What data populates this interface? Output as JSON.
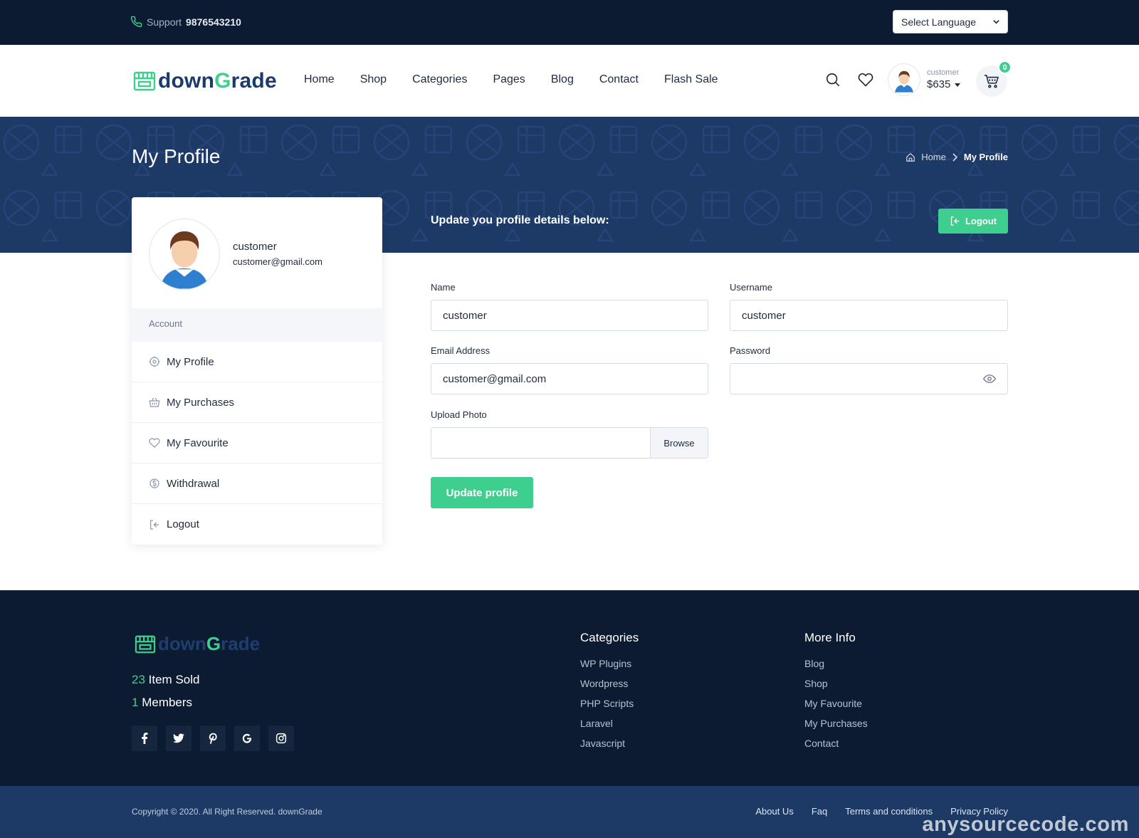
{
  "topbar": {
    "support_label": "Support",
    "support_phone": "9876543210",
    "language_select": "Select Language"
  },
  "header": {
    "logo_part1": "down",
    "logo_g": "G",
    "logo_part2": "rade",
    "nav": [
      "Home",
      "Shop",
      "Categories",
      "Pages",
      "Blog",
      "Contact",
      "Flash Sale"
    ],
    "user": {
      "username": "customer",
      "balance": "$635"
    },
    "cart_count": "0"
  },
  "banner": {
    "title": "My Profile",
    "breadcrumb_home": "Home",
    "breadcrumb_current": "My Profile",
    "update_title": "Update you profile details below:",
    "logout_label": "Logout"
  },
  "sidebar": {
    "name": "customer",
    "email": "customer@gmail.com",
    "section_label": "Account",
    "items": [
      {
        "label": "My Profile",
        "icon": "gear-icon"
      },
      {
        "label": "My Purchases",
        "icon": "basket-icon"
      },
      {
        "label": "My Favourite",
        "icon": "heart-icon"
      },
      {
        "label": "Withdrawal",
        "icon": "money-icon"
      },
      {
        "label": "Logout",
        "icon": "logout-icon"
      }
    ]
  },
  "form": {
    "name_label": "Name",
    "name_value": "customer",
    "username_label": "Username",
    "username_value": "customer",
    "email_label": "Email Address",
    "email_value": "customer@gmail.com",
    "password_label": "Password",
    "password_value": "",
    "upload_label": "Upload Photo",
    "browse_label": "Browse",
    "submit_label": "Update profile"
  },
  "footer": {
    "items_sold_count": "23",
    "items_sold_label": "Item Sold",
    "members_count": "1",
    "members_label": "Members",
    "socials": [
      "facebook-icon",
      "twitter-icon",
      "pinterest-icon",
      "google-icon",
      "instagram-icon"
    ],
    "categories_title": "Categories",
    "categories": [
      "WP Plugins",
      "Wordpress",
      "PHP Scripts",
      "Laravel",
      "Javascript"
    ],
    "more_info_title": "More Info",
    "more_info": [
      "Blog",
      "Shop",
      "My Favourite",
      "My Purchases",
      "Contact"
    ],
    "copyright": "Copyright © 2020. All Right Reserved. downGrade",
    "bottom_links": [
      "About Us",
      "Faq",
      "Terms and conditions",
      "Privacy Policy"
    ],
    "watermark": "anysourcecode.com"
  },
  "colors": {
    "navy": "#0d1b32",
    "banner_blue": "#1d3966",
    "accent_green": "#3ecf8e",
    "logo_blue": "#1c3a6c"
  }
}
